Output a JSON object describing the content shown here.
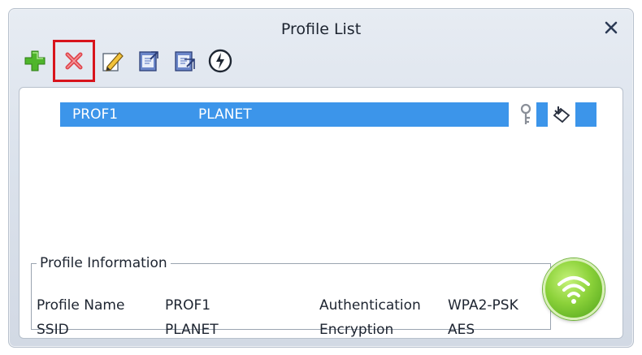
{
  "window": {
    "title": "Profile List"
  },
  "toolbar": {
    "buttons": [
      {
        "name": "add-profile-button",
        "icon": "plus-icon"
      },
      {
        "name": "delete-profile-button",
        "icon": "delete-x-icon"
      },
      {
        "name": "edit-profile-button",
        "icon": "edit-pencil-icon"
      },
      {
        "name": "import-profile-button",
        "icon": "import-doc-icon"
      },
      {
        "name": "export-profile-button",
        "icon": "export-doc-icon"
      },
      {
        "name": "connect-profile-button",
        "icon": "wireless-connect-icon"
      }
    ]
  },
  "profiles": [
    {
      "profile_name": "PROF1",
      "ssid": "PLANET",
      "icons": [
        "key-icon",
        "connect-arrow-icon"
      ]
    }
  ],
  "profile_info": {
    "legend": "Profile Information",
    "profile_name_label": "Profile Name",
    "profile_name_value": "PROF1",
    "ssid_label": "SSID",
    "ssid_value": "PLANET",
    "authentication_label": "Authentication",
    "authentication_value": "WPA2-PSK",
    "encryption_label": "Encryption",
    "encryption_value": "AES"
  },
  "colors": {
    "selection": "#3c95ea",
    "highlight_border": "#d8141c",
    "wifi_green": "#8cd23a"
  }
}
